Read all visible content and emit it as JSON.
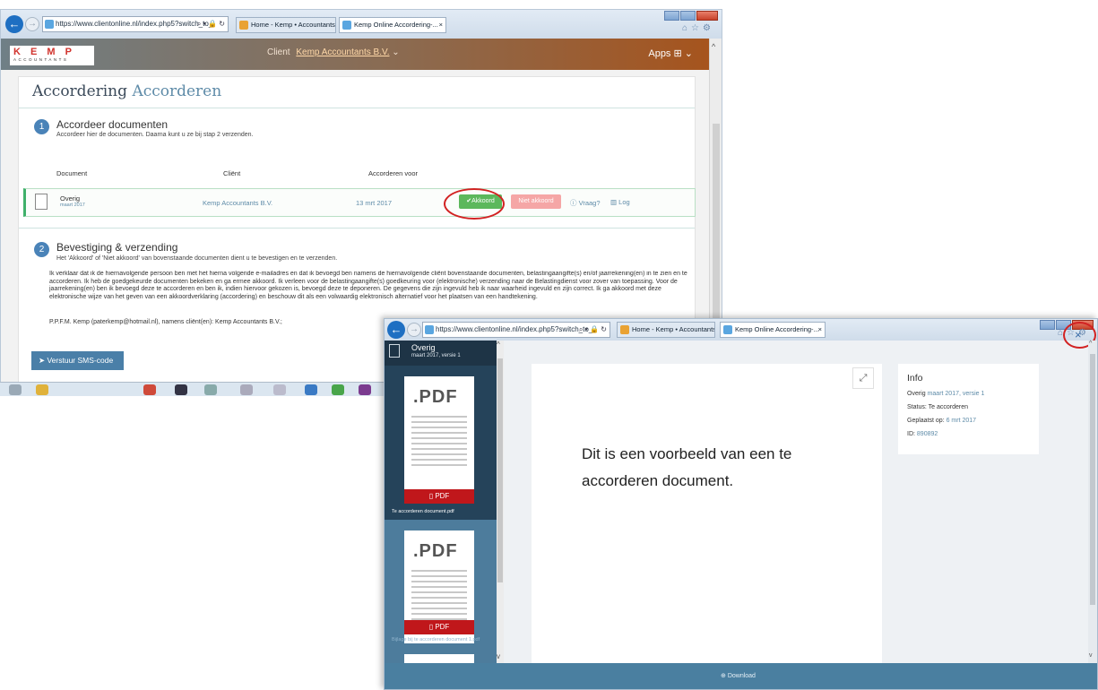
{
  "win1": {
    "browser": {
      "url": "https://www.clientonline.nl/index.php5?switch_to_",
      "tab1": "Home - Kemp • Accountants",
      "tab2": "Kemp Online Accordering-...",
      "tab2_close": "×"
    },
    "header": {
      "logo_main": "K E M P",
      "logo_sub": "ACCOUNTANTS",
      "client_label": "Client",
      "client_name": "Kemp Accountants B.V.",
      "apps_label": "Apps"
    },
    "page": {
      "title_a": "Accordering",
      "title_b": "Accorderen",
      "step1": {
        "num": "1",
        "title": "Accordeer documenten",
        "subtitle": "Accordeer hier de documenten. Daarna kunt u ze bij stap 2 verzenden."
      },
      "columns": [
        "Document",
        "Cliënt",
        "Accorderen voor"
      ],
      "row": {
        "name": "Overig",
        "date": "maart 2017",
        "client": "Kemp Accountants B.V.",
        "deadline": "13 mrt 2017",
        "approve": "Akkoord",
        "reject": "Niet akkoord",
        "question": "Vraag?",
        "log": "Log"
      },
      "step2": {
        "num": "2",
        "title": "Bevestiging & verzending",
        "subtitle": "Het 'Akkoord' of 'Niet akkoord' van bovenstaande documenten dient u te bevestigen en te verzenden."
      },
      "declaration": "Ik verklaar dat ik de hiernavolgende persoon ben met het hierna volgende e-mailadres en dat ik bevoegd ben namens de hiernavolgende cliënt bovenstaande documenten, belastingaangifte(s) en/of jaarrekening(en) in te zien en te accorderen. Ik heb de goedgekeurde documenten bekeken en ga ermee akkoord. Ik verleen voor de belastingaangifte(s) goedkeuring voor (elektronische) verzending naar de Belastingdienst voor zover van toepassing. Voor de jaarrekening(en) ben ik bevoegd deze te accorderen en ben ik, indien hiervoor gekozen is, bevoegd deze te deponeren. De gegevens die zijn ingevuld heb ik naar waarheid ingevuld en zijn correct. Ik ga akkoord met deze elektronische wijze van het geven van een akkoordverklaring (accordering) en beschouw dit als een volwaardig elektronisch alternatief voor het plaatsen van een handtekening.",
      "signature": "P.P.F.M. Kemp (paterkemp@hotmail.nl), namens cliënt(en): Kemp Accountants B.V.;",
      "sms_button": "Verstuur SMS-code"
    }
  },
  "win2": {
    "browser": {
      "url": "https://www.clientonline.nl/index.php5?switch_to_",
      "tab1": "Home - Kemp • Accountants",
      "tab2": "Kemp Online Accordering-...",
      "tab2_close": "×"
    },
    "sidebar": {
      "title": "Overig",
      "subtitle": "maart 2017, versie 1",
      "thumbs": [
        {
          "label": ".PDF",
          "badge": "PDF",
          "caption": "Te accorderen document.pdf"
        },
        {
          "label": ".PDF",
          "badge": "PDF",
          "caption": "Bijlage bij te accorderen document 1.pdf"
        }
      ]
    },
    "viewer": {
      "text": "Dit is een voorbeeld van een te accorderen document."
    },
    "info": {
      "title": "Info",
      "doc_name": "Overig",
      "doc_version": "maart 2017, versie 1",
      "status_label": "Status:",
      "status_value": "Te accorderen",
      "placed_label": "Geplaatst op:",
      "placed_value": "6 mrt 2017",
      "id_label": "ID:",
      "id_value": "890892"
    },
    "close": "×",
    "download": "Download"
  }
}
